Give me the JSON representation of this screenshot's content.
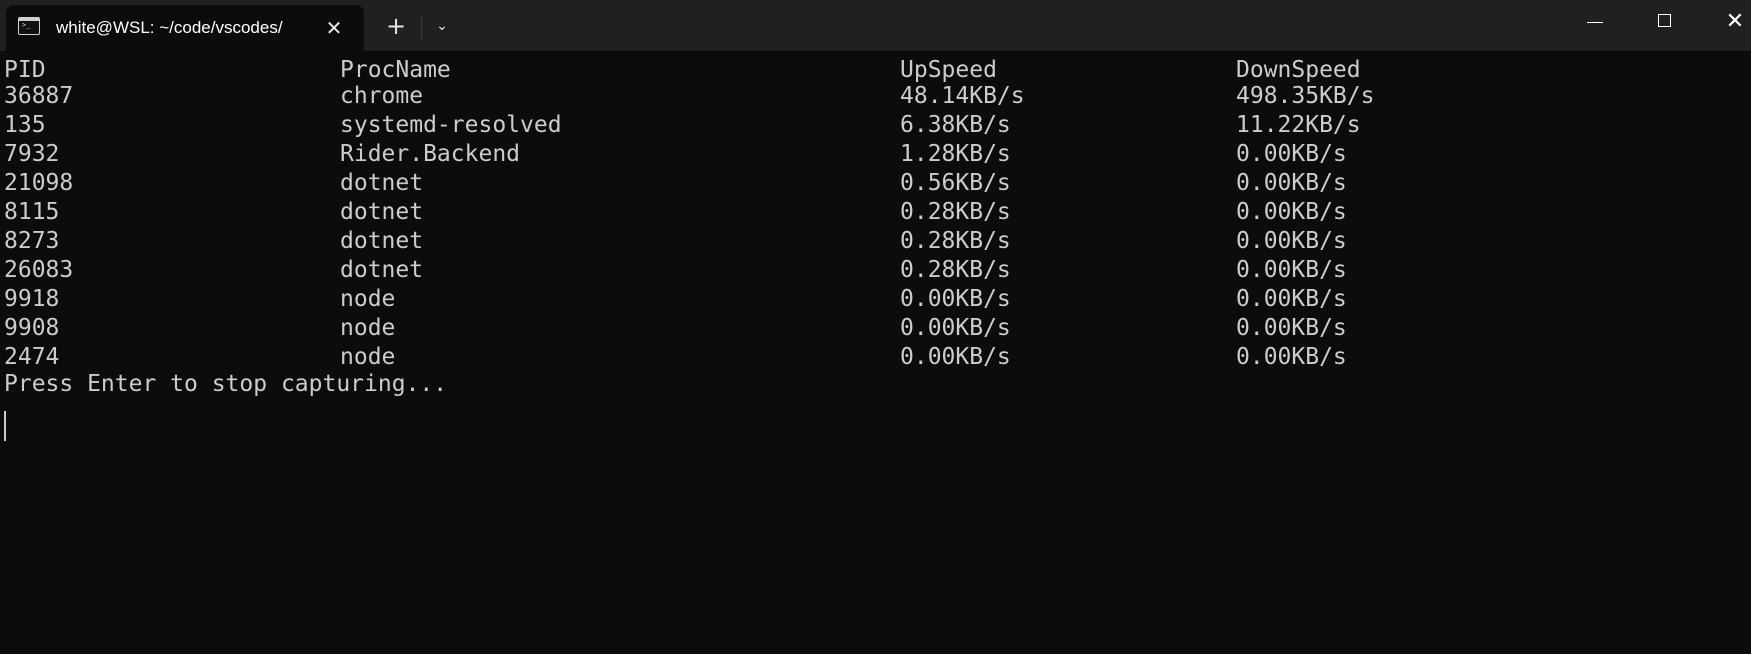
{
  "window": {
    "tab_title": "white@WSL: ~/code/vscodes/",
    "tab_icon": "terminal-icon",
    "new_tab_glyph": "+",
    "dropdown_glyph": "⌄",
    "close_tab_glyph": "✕",
    "minimize_glyph": "—",
    "maximize_glyph": "☐",
    "close_glyph": "✕"
  },
  "terminal": {
    "headers": {
      "pid": "PID",
      "name": "ProcName",
      "up": "UpSpeed",
      "down": "DownSpeed"
    },
    "rows": [
      {
        "pid": "36887",
        "name": "chrome",
        "up": "48.14KB/s",
        "down": "498.35KB/s"
      },
      {
        "pid": "135",
        "name": "systemd-resolved",
        "up": "6.38KB/s",
        "down": "11.22KB/s"
      },
      {
        "pid": "7932",
        "name": "Rider.Backend",
        "up": "1.28KB/s",
        "down": "0.00KB/s"
      },
      {
        "pid": "21098",
        "name": "dotnet",
        "up": "0.56KB/s",
        "down": "0.00KB/s"
      },
      {
        "pid": "8115",
        "name": "dotnet",
        "up": "0.28KB/s",
        "down": "0.00KB/s"
      },
      {
        "pid": "8273",
        "name": "dotnet",
        "up": "0.28KB/s",
        "down": "0.00KB/s"
      },
      {
        "pid": "26083",
        "name": "dotnet",
        "up": "0.28KB/s",
        "down": "0.00KB/s"
      },
      {
        "pid": "9918",
        "name": "node",
        "up": "0.00KB/s",
        "down": "0.00KB/s"
      },
      {
        "pid": "9908",
        "name": "node",
        "up": "0.00KB/s",
        "down": "0.00KB/s"
      },
      {
        "pid": "2474",
        "name": "node",
        "up": "0.00KB/s",
        "down": "0.00KB/s"
      }
    ],
    "prompt": "Press Enter to stop capturing..."
  },
  "colors": {
    "background": "#0c0c0c",
    "titlebar": "#202020",
    "text": "#cccccc"
  }
}
